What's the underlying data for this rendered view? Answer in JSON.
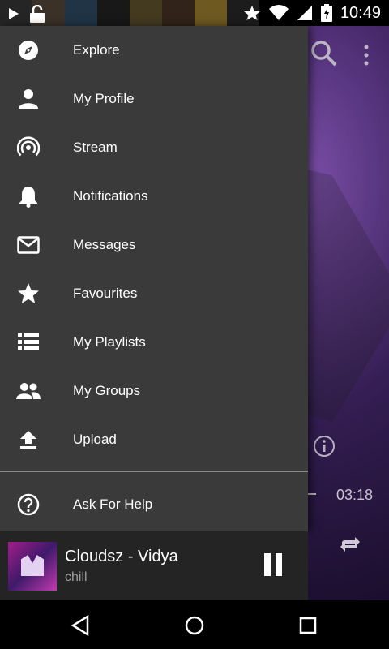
{
  "status_bar": {
    "time": "10:49"
  },
  "drawer": {
    "items": [
      {
        "label": "Explore",
        "icon": "compass-icon"
      },
      {
        "label": "My Profile",
        "icon": "person-icon"
      },
      {
        "label": "Stream",
        "icon": "stream-icon"
      },
      {
        "label": "Notifications",
        "icon": "bell-icon"
      },
      {
        "label": "Messages",
        "icon": "mail-icon"
      },
      {
        "label": "Favourites",
        "icon": "star-icon"
      },
      {
        "label": "My Playlists",
        "icon": "list-icon"
      },
      {
        "label": "My Groups",
        "icon": "group-icon"
      },
      {
        "label": "Upload",
        "icon": "upload-icon"
      }
    ],
    "footer_item": {
      "label": "Ask For Help",
      "icon": "help-icon"
    }
  },
  "player": {
    "elapsed": "03:18"
  },
  "mini_player": {
    "title": "Cloudsz - Vidya",
    "subtitle": "chill"
  }
}
